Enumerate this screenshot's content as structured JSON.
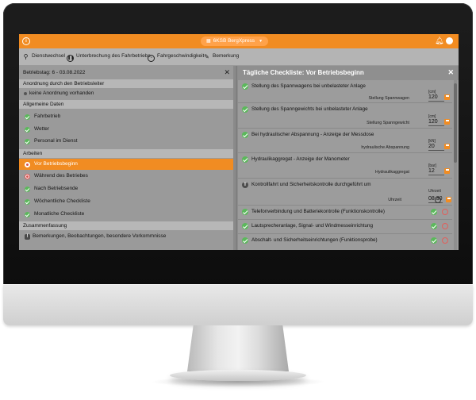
{
  "topbar": {
    "title": "6KSB BergXpress",
    "colors": {
      "accent": "#f18c22",
      "screen_bg": "#8d8d8d"
    }
  },
  "toolbar": {
    "items": [
      {
        "label": "Dienstwechsel",
        "icon": "person-walk-icon"
      },
      {
        "label": "Unterbrechung des Fahrbetriebs",
        "icon": "pause-circle-icon"
      },
      {
        "label": "Fahrgeschwindigkeit",
        "icon": "speedometer-icon"
      },
      {
        "label": "Bemerkung",
        "icon": "pencil-icon"
      }
    ]
  },
  "left": {
    "header": "Betriebstag: 6 - 03.08.2022",
    "order": {
      "title": "Anordnung durch den Betriebsleiter",
      "note": "keine Anordnung vorhanden"
    },
    "general": {
      "title": "Allgemeine Daten",
      "items": [
        "Fahrbetrieb",
        "Wetter",
        "Personal im Dienst"
      ]
    },
    "work": {
      "title": "Arbeiten",
      "items": [
        "Vor Betriebsbeginn",
        "Während des Betriebes",
        "Nach Betriebsende",
        "Wöchentliche Checkliste",
        "Monatliche Checkliste"
      ]
    },
    "summary": {
      "title": "Zusammenfassung",
      "items": [
        "Bemerkungen, Beobachtungen, besondere Vorkommnisse"
      ]
    }
  },
  "right": {
    "header": "Tägliche Checkliste: Vor Betriebsbeginn",
    "items": [
      {
        "title": "Stellung des Spannwagens bei unbelasteter Anlage",
        "unit": "[cm]",
        "field_label": "Stellung Spannwagen",
        "value": "120"
      },
      {
        "title": "Stellung des Spanngewichts bei unbelasteter Anlage",
        "unit": "[cm]",
        "field_label": "Stellung Spanngewicht",
        "value": "120"
      },
      {
        "title": "Bei hydraulischer Abspannung - Anzeige der Messdose",
        "unit": "[kN]",
        "field_label": "hydraulische Abspannung",
        "value": "20"
      },
      {
        "title": "Hydraulikaggregat - Anzeige der Manometer",
        "unit": "[bar]",
        "field_label": "Hydraulikaggregat",
        "value": "12"
      },
      {
        "title": "Kontrollfahrt und Sicherheitskontrolle durchgeführt um",
        "unit": "Uhrzeit",
        "field_label": "Uhrzeit",
        "value": "08:30",
        "icon_letter": "T"
      },
      {
        "title": "Telefonverbindung und Batteriekontrolle (Funktionskontrolle)"
      },
      {
        "title": "Lautsprecheranlage, Signal- und Windmesseinrichtung"
      },
      {
        "title": "Abschalt- und Sicherheitseinrichtungen (Funktionsprobe)"
      }
    ]
  }
}
